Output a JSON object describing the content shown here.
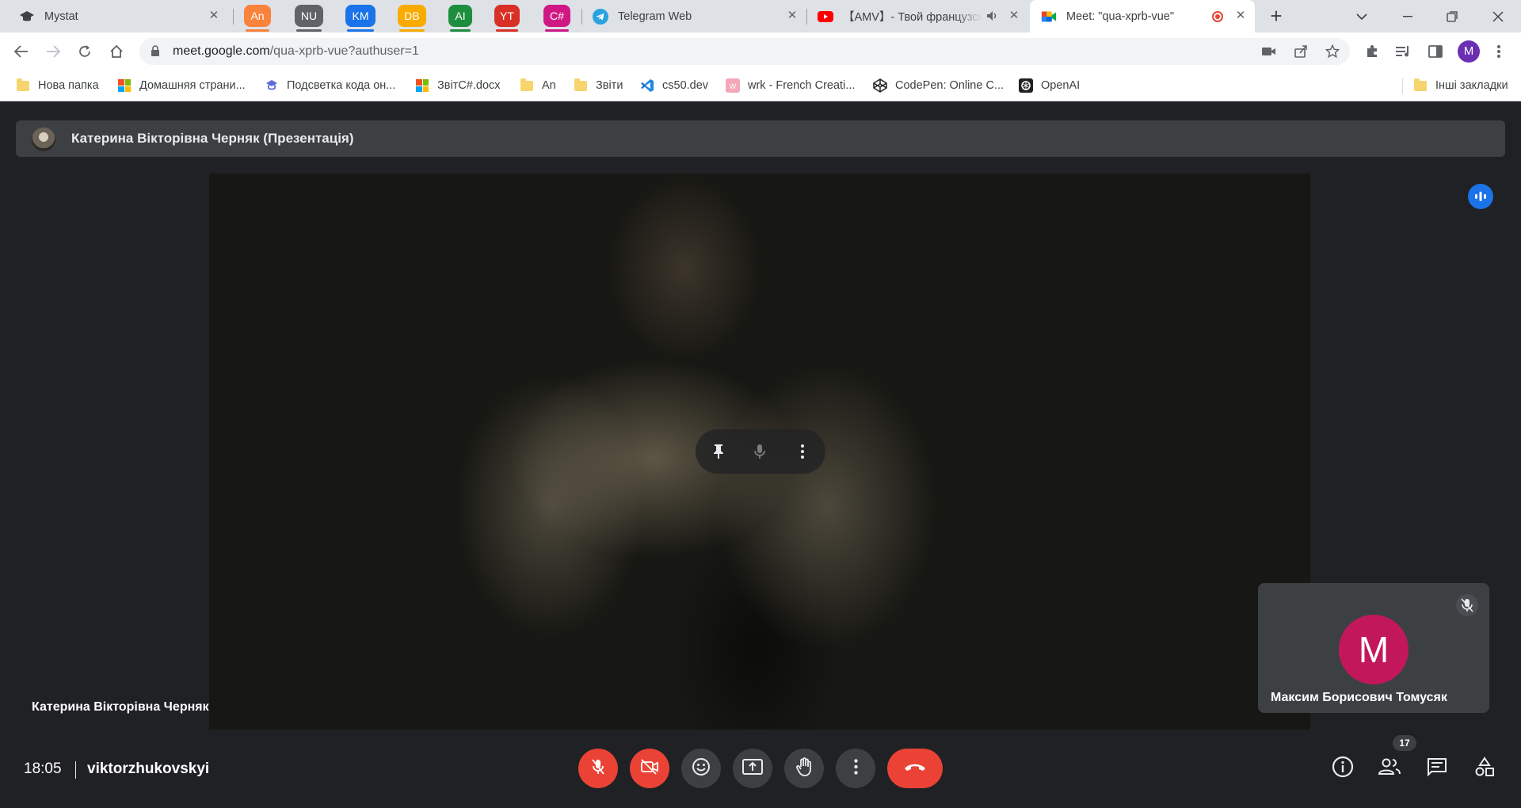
{
  "browser": {
    "tabs": [
      {
        "title": "Mystat"
      },
      {
        "title": "Telegram Web"
      },
      {
        "title": "【AMV】- Твой французский"
      },
      {
        "title": "Meet: \"qua-xprb-vue\""
      }
    ],
    "group_tabs": [
      {
        "label": "An",
        "color": "#f9833b"
      },
      {
        "label": "NU",
        "color": "#5f6368"
      },
      {
        "label": "KM",
        "color": "#1a73e8"
      },
      {
        "label": "DB",
        "color": "#f9ab00"
      },
      {
        "label": "AI",
        "color": "#1e8e3e"
      },
      {
        "label": "YT",
        "color": "#d93025"
      },
      {
        "label": "C#",
        "color": "#d01884"
      }
    ],
    "url": {
      "host": "meet.google.com",
      "path": "/qua-xprb-vue?authuser=1"
    },
    "profile_initial": "M",
    "bookmarks": [
      {
        "label": "Нова папка",
        "icon": "folder-icon"
      },
      {
        "label": "Домашняя страни...",
        "icon": "windows-icon"
      },
      {
        "label": "Подсветка кода он...",
        "icon": "code-highlight-icon"
      },
      {
        "label": "ЗвітC#.docx",
        "icon": "windows-icon"
      },
      {
        "label": "An",
        "icon": "folder-icon"
      },
      {
        "label": "Звіти",
        "icon": "folder-icon"
      },
      {
        "label": "cs50.dev",
        "icon": "vscode-icon"
      },
      {
        "label": "wrk - French Creati...",
        "icon": "wrk-icon"
      },
      {
        "label": "CodePen: Online C...",
        "icon": "codepen-icon"
      },
      {
        "label": "OpenAI",
        "icon": "openai-icon"
      }
    ],
    "other_bookmarks": "Інші закладки"
  },
  "meet": {
    "presenter_title": "Катерина Вікторівна Черняк (Презентація)",
    "speaker_name": "Катерина Вікторівна Черняк",
    "self_name": "Максим Борисович Томусяк",
    "self_initial": "M",
    "time": "18:05",
    "meeting_code": "viktorzhukovskyi",
    "participant_count": "17",
    "colors": {
      "accent": "#1a73e8",
      "danger": "#ea4335",
      "avatar": "#c2185b"
    }
  }
}
